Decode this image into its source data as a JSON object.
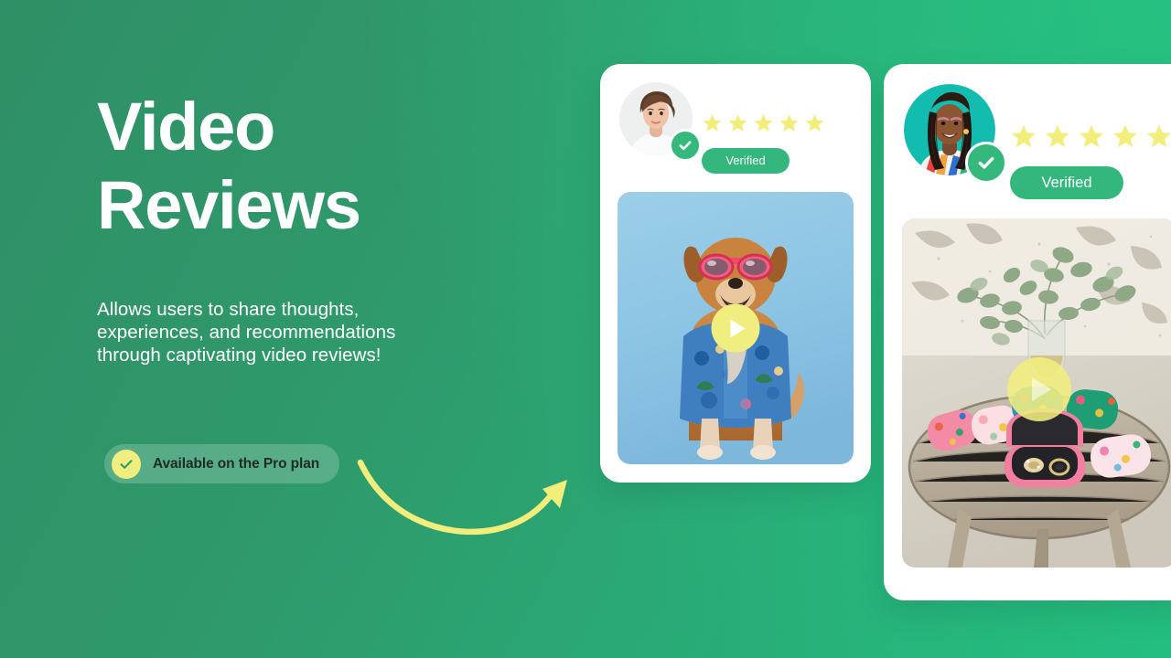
{
  "theme": {
    "bg_gradient_from": "#2f8f66",
    "bg_gradient_to": "#23bd80",
    "accent_yellow": "#f0ee7e",
    "accent_green": "#34b77d",
    "card_bg": "#ffffff",
    "text_on_dark": "#ffffff"
  },
  "hero": {
    "title": "Video\nReviews",
    "description": "Allows users to share thoughts,\nexperiences, and recommendations\nthrough captivating video reviews!",
    "badge": {
      "label": "Available on the Pro plan",
      "icon": "check-circle-icon"
    },
    "arrow_icon": "curved-arrow-icon"
  },
  "cards": [
    {
      "id": "review-card-1",
      "avatar_alt": "short-haired woman portrait",
      "verified_icon": "check-badge-icon",
      "rating": 5,
      "stars_max": 5,
      "verified_label": "Verified",
      "video": {
        "alt": "dog wearing pink sunglasses and a blue hawaiian shirt on a light blue background",
        "play_label": "play-button",
        "bg_color": "#8cc4e4"
      }
    },
    {
      "id": "review-card-2",
      "avatar_alt": "smiling woman with braids on a teal background",
      "verified_icon": "check-badge-icon",
      "rating": 5,
      "stars_max": 5,
      "verified_label": "Verified",
      "video": {
        "alt": "floral jewelry cases and rings on a round wooden table with eucalyptus in a vase",
        "play_label": "play-button",
        "bg_color": "#cfcabb"
      }
    }
  ]
}
